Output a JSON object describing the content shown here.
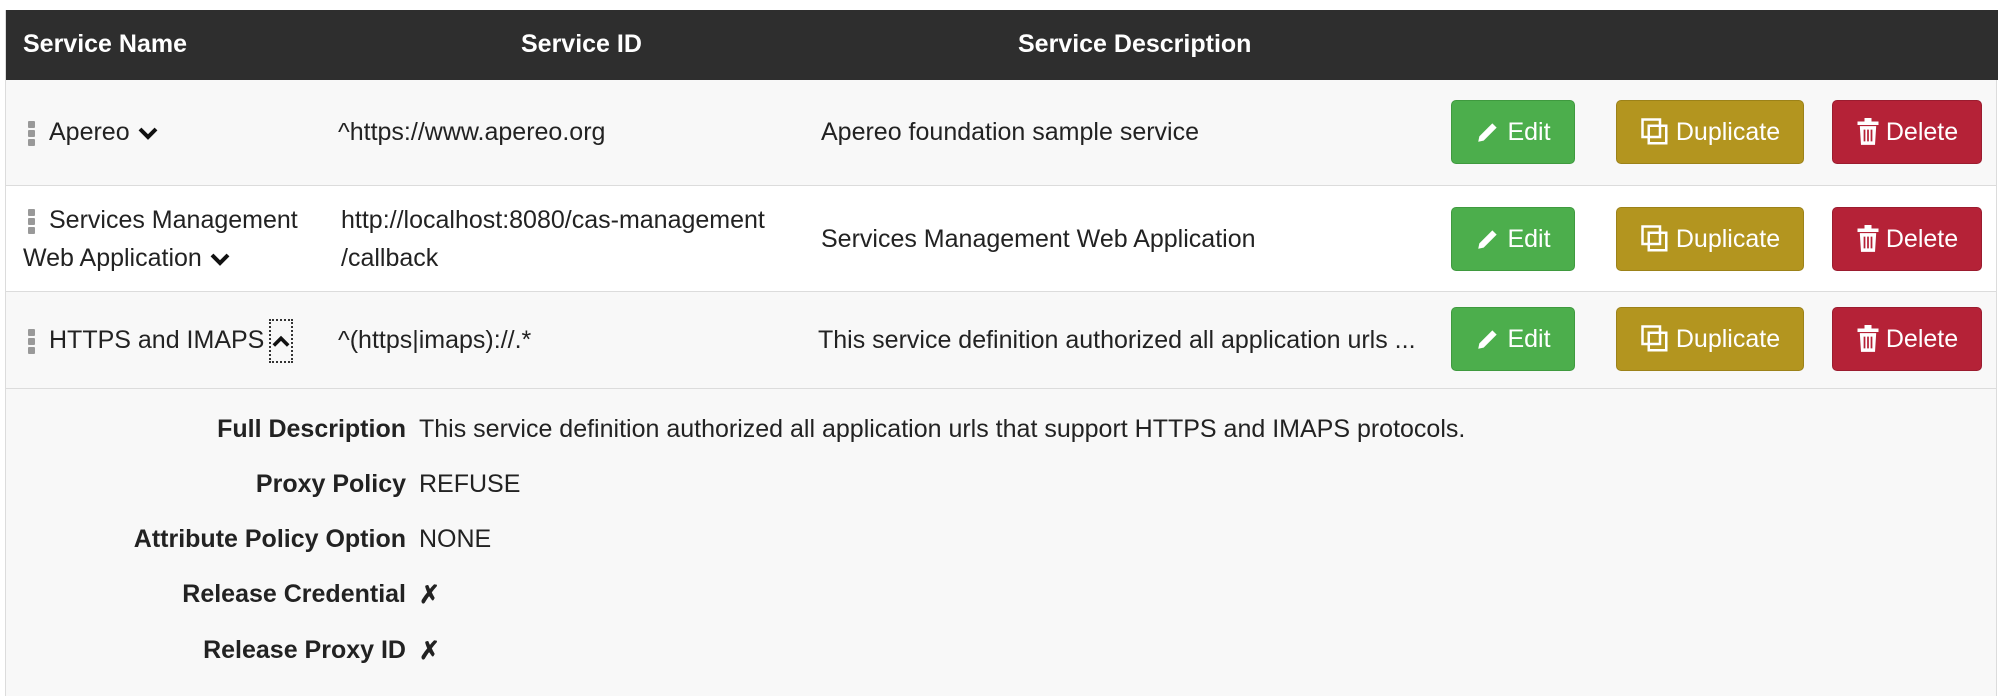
{
  "header": {
    "service_name": "Service Name",
    "service_id": "Service ID",
    "service_description": "Service Description"
  },
  "rows": [
    {
      "name": "Apereo",
      "service_id": "^https://www.apereo.org",
      "description": "Apereo foundation sample service",
      "expanded": false
    },
    {
      "name_line1": "Services Management",
      "name_line2": "Web Application",
      "service_id_line1": "http://localhost:8080/cas-management",
      "service_id_line2": "/callback",
      "description": "Services Management Web Application",
      "expanded": false
    },
    {
      "name": "HTTPS and IMAPS",
      "service_id": "^(https|imaps)://.*",
      "description": "This service definition authorized all application urls ...",
      "expanded": true
    }
  ],
  "actions": {
    "edit": "Edit",
    "duplicate": "Duplicate",
    "delete": "Delete"
  },
  "details": {
    "full_description_label": "Full Description",
    "full_description": "This service definition authorized all application urls that support HTTPS and IMAPS protocols.",
    "proxy_policy_label": "Proxy Policy",
    "proxy_policy": "REFUSE",
    "attribute_policy_label": "Attribute Policy Option",
    "attribute_policy": "NONE",
    "release_credential_label": "Release Credential",
    "release_credential": "✗",
    "release_proxy_id_label": "Release Proxy ID",
    "release_proxy_id": "✗"
  },
  "colors": {
    "header_bg": "#2e2e2e",
    "edit": "#4cae4c",
    "duplicate": "#b3951f",
    "delete": "#b52237"
  },
  "icons": [
    "drag-handle-icon",
    "chevron-down-icon",
    "chevron-up-icon",
    "pencil-icon",
    "copy-icon",
    "trash-icon"
  ]
}
